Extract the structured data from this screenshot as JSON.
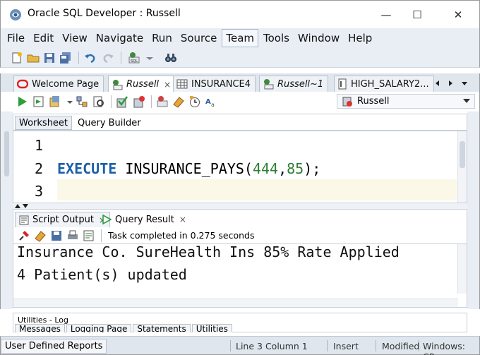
{
  "window": {
    "title": "Oracle SQL Developer : Russell",
    "minimize_glyph": "—",
    "maximize_glyph": "☐",
    "close_glyph": "✕"
  },
  "menu": [
    "File",
    "Edit",
    "View",
    "Navigate",
    "Run",
    "Source",
    "Team",
    "Tools",
    "Window",
    "Help"
  ],
  "menu_active": "Team",
  "editor_tabs": [
    {
      "label": "Welcome Page",
      "icon": "oracle-icon",
      "italic": false
    },
    {
      "label": "Russell",
      "icon": "sql-connection-icon",
      "italic": true,
      "active": true
    },
    {
      "label": "INSURANCE4",
      "icon": "table-icon",
      "italic": false
    },
    {
      "label": "Russell~1",
      "icon": "sql-connection-icon",
      "italic": true
    },
    {
      "label": "HIGH_SALARY2...",
      "icon": "procedure-icon",
      "italic": false
    }
  ],
  "tab_close": "×",
  "connection": {
    "selected": "Russell"
  },
  "worksheet_tabs": [
    "Worksheet",
    "Query Builder"
  ],
  "editor": {
    "line_numbers": [
      "1",
      "2",
      "3"
    ],
    "code": {
      "keyword": "EXECUTE",
      "name": " INSURANCE_PAYS(",
      "arg1": "444",
      "comma": ",",
      "arg2": "85",
      "end": ");"
    }
  },
  "output_tabs": [
    {
      "label": "Script Output",
      "icon": "script-output-icon",
      "active": true
    },
    {
      "label": "Query Result",
      "icon": "run-icon"
    }
  ],
  "output": {
    "task_status": "Task completed in 0.275 seconds",
    "lines": [
      "Insurance Co. SureHealth Ins 85% Rate Applied",
      "4 Patient(s) updated"
    ]
  },
  "utilities": {
    "title": "Utilities - Log",
    "tabs": [
      "Messages",
      "Logging Page",
      "Statements",
      "Utilities"
    ]
  },
  "statusbar": {
    "left_button": "User Defined Reports",
    "position": "Line 3 Column 1",
    "mode": "Insert",
    "modified": "Modified",
    "eol": "Windows: CR"
  },
  "colors": {
    "keyword": "#1b5fa8",
    "number": "#2e7d32",
    "chrome": "#e9eef5"
  }
}
